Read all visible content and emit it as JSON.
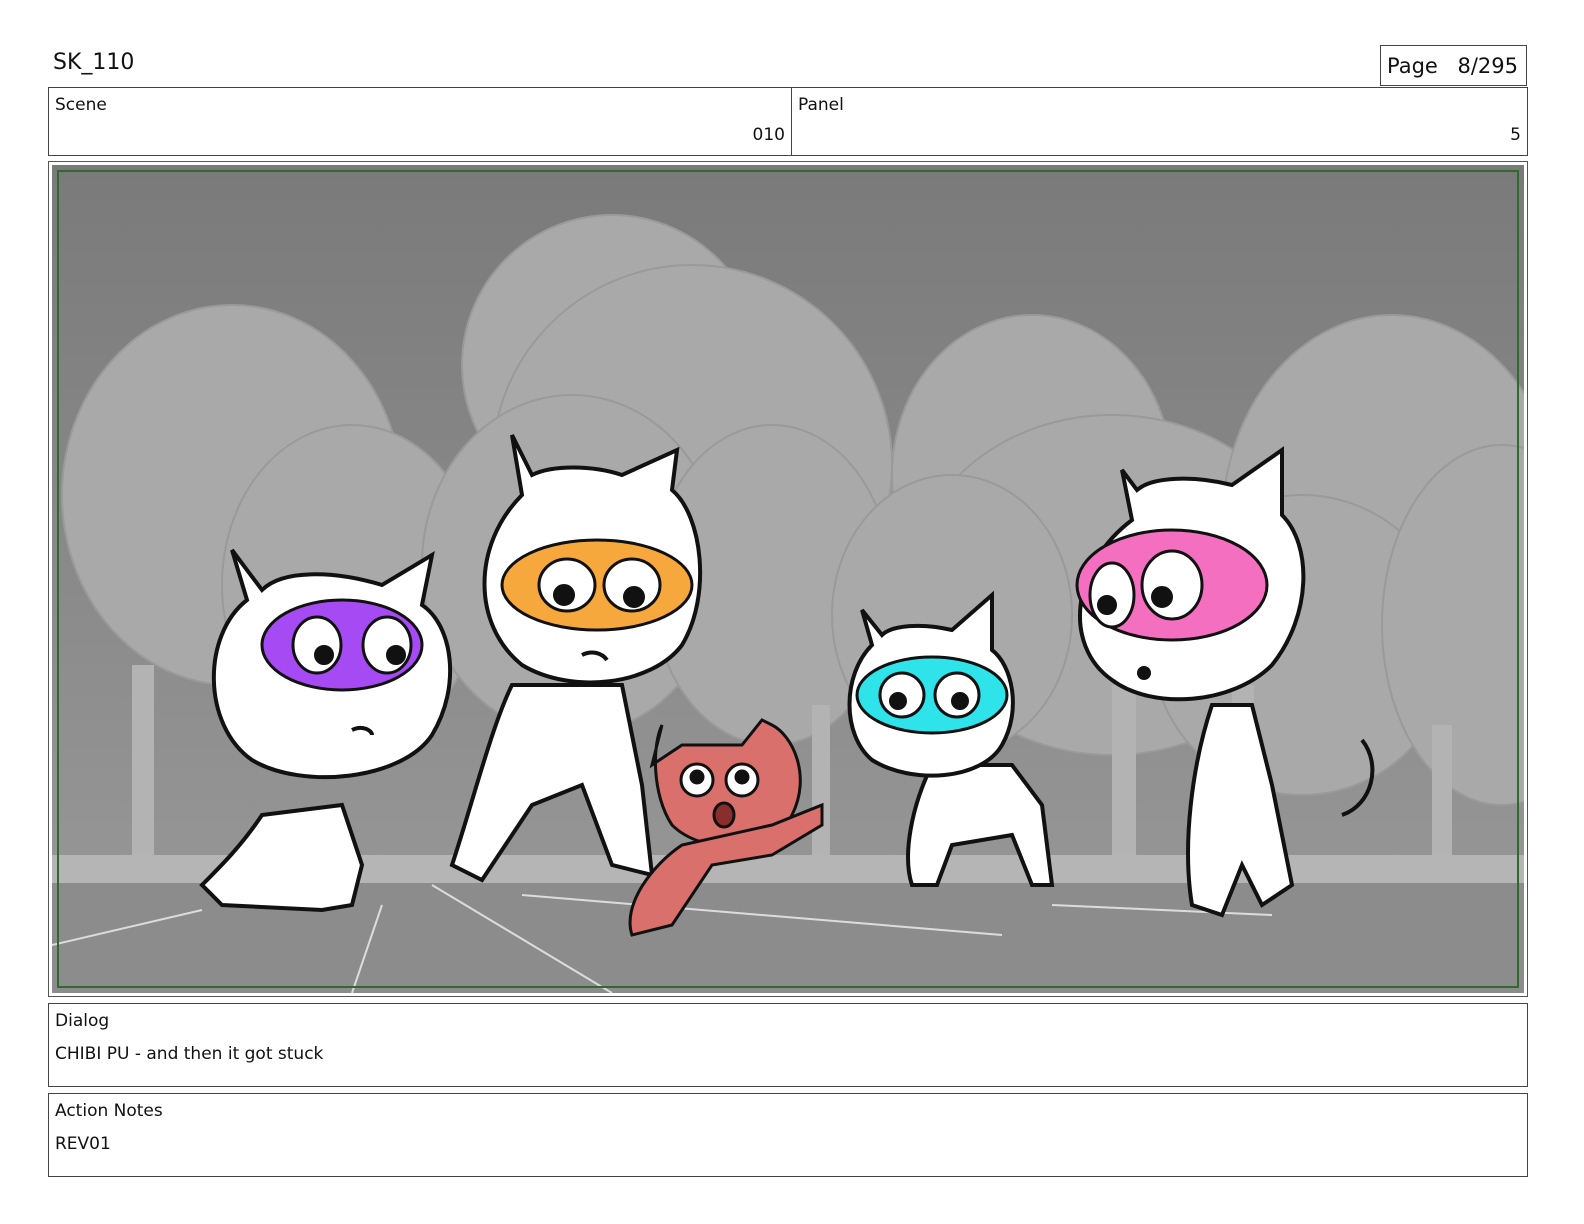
{
  "header": {
    "title": "SK_110",
    "page_label": "Page",
    "page_value": "8/295"
  },
  "scene": {
    "label": "Scene",
    "value": "010"
  },
  "panel": {
    "label": "Panel",
    "value": "5"
  },
  "frame": {
    "description_icon": "storyboard-panel-image",
    "characters": [
      {
        "name": "purple-mask-cat",
        "mask_color": "#a64bf4"
      },
      {
        "name": "orange-mask-cat",
        "mask_color": "#f6a83c"
      },
      {
        "name": "red-kitten",
        "body_color": "#d9706c"
      },
      {
        "name": "cyan-mask-cat",
        "mask_color": "#2fe3ea"
      },
      {
        "name": "pink-mask-cat",
        "mask_color": "#f46fbf"
      }
    ],
    "frame_border_color": "#2e6b2e"
  },
  "dialog": {
    "label": "Dialog",
    "text": "CHIBI PU - and then it got stuck"
  },
  "notes": {
    "label": "Action Notes",
    "text": "REV01"
  }
}
